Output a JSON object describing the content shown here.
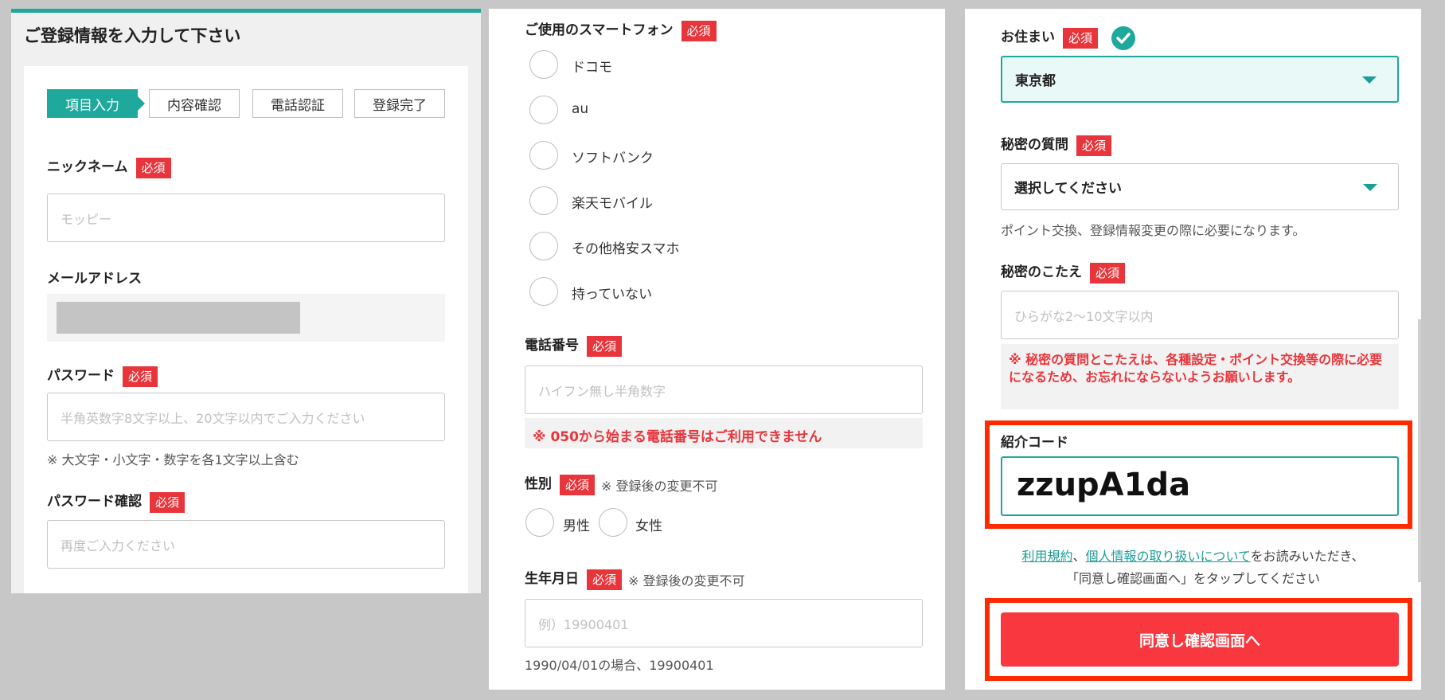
{
  "colors": {
    "accent": "#1fa89c",
    "required": "#e8353b",
    "highlight": "#ff2a00"
  },
  "required_badge": "必須",
  "panel1": {
    "title": "ご登録情報を入力して下さい",
    "steps": [
      "項目入力",
      "内容確認",
      "電話認証",
      "登録完了"
    ],
    "nickname": {
      "label": "ニックネーム",
      "placeholder": "モッピー"
    },
    "email": {
      "label": "メールアドレス"
    },
    "password": {
      "label": "パスワード",
      "placeholder": "半角英数字8文字以上、20文字以内でご入力ください",
      "note": "※ 大文字・小文字・数字を各1文字以上含む"
    },
    "password_confirm": {
      "label": "パスワード確認",
      "placeholder": "再度ご入力ください"
    }
  },
  "panel2": {
    "smartphone": {
      "label": "ご使用のスマートフォン",
      "options": [
        "ドコモ",
        "au",
        "ソフトバンク",
        "楽天モバイル",
        "その他格安スマホ",
        "持っていない"
      ]
    },
    "phone": {
      "label": "電話番号",
      "placeholder": "ハイフン無し半角数字",
      "warning": "※ 050から始まる電話番号はご利用できません"
    },
    "gender": {
      "label": "性別",
      "note": "※ 登録後の変更不可",
      "options": [
        "男性",
        "女性"
      ]
    },
    "birthday": {
      "label": "生年月日",
      "note": "※ 登録後の変更不可",
      "placeholder": "例）19900401",
      "hint": "1990/04/01の場合、19900401"
    }
  },
  "panel3": {
    "residence": {
      "label": "お住まい",
      "value": "東京都"
    },
    "secret_question": {
      "label": "秘密の質問",
      "value": "選択してください",
      "note": "ポイント交換、登録情報変更の際に必要になります。"
    },
    "secret_answer": {
      "label": "秘密のこたえ",
      "placeholder": "ひらがな2〜10文字以内",
      "warning": "※ 秘密の質問とこたえは、各種設定・ポイント交換等の際に必要になるため、お忘れにならないようお願いします。"
    },
    "referral": {
      "label": "紹介コード",
      "value": "zzupA1da"
    },
    "terms": {
      "link1": "利用規約",
      "sep": "、",
      "link2": "個人情報の取り扱いについて",
      "text1": "をお読みいただき、",
      "text2": "「同意し確認画面へ」をタップしてください"
    },
    "submit_label": "同意し確認画面へ"
  }
}
